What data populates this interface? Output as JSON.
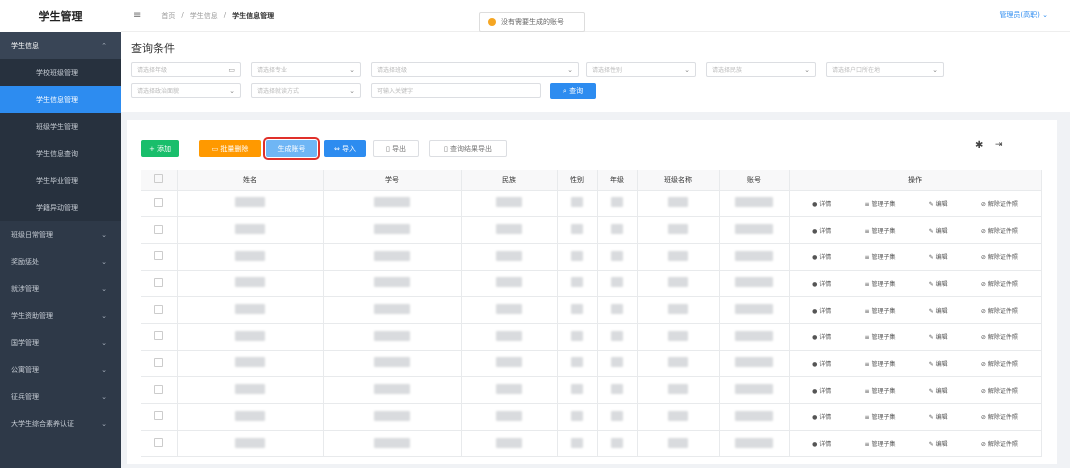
{
  "sidebar": {
    "title": "学生管理",
    "items": [
      {
        "label": "学生信息",
        "type": "parent",
        "chevron": "chevron-up"
      },
      {
        "label": "学校班级管理",
        "type": "sub"
      },
      {
        "label": "学生信息管理",
        "type": "sub-active"
      },
      {
        "label": "班级学生管理",
        "type": "sub"
      },
      {
        "label": "学生信息查询",
        "type": "sub"
      },
      {
        "label": "学生毕业管理",
        "type": "sub"
      },
      {
        "label": "学籍异动管理",
        "type": "sub"
      },
      {
        "label": "班级日常管理",
        "type": "group"
      },
      {
        "label": "奖励惩处",
        "type": "group"
      },
      {
        "label": "就涉管理",
        "type": "group"
      },
      {
        "label": "学生资助管理",
        "type": "group"
      },
      {
        "label": "国学管理",
        "type": "group"
      },
      {
        "label": "公寓管理",
        "type": "group"
      },
      {
        "label": "征兵管理",
        "type": "group"
      },
      {
        "label": "大学生综合素养认证",
        "type": "group"
      }
    ]
  },
  "topbar": {
    "breadcrumb": [
      "首页",
      "学生信息",
      "学生信息管理"
    ],
    "notice": "没有需要生成的账号",
    "user": "管理员(高职)"
  },
  "query": {
    "title": "查询条件",
    "fields": [
      "请选择年级",
      "请选择专业",
      "请选择班级",
      "请选择性别",
      "请选择民族",
      "请选择户口所在地",
      "请选择政治面貌",
      "请选择就读方式",
      "可输入关键字"
    ],
    "search_label": "查询"
  },
  "toolbar": {
    "add": "+ 添加",
    "batch_delete": "批量删除",
    "generate_account": "生成账号",
    "import": "导入",
    "export": "导出",
    "query_export": "查询结果导出"
  },
  "table": {
    "headers": [
      "",
      "姓名",
      "学号",
      "民族",
      "性别",
      "年级",
      "班级名称",
      "账号",
      "操作"
    ],
    "ops": [
      "详情",
      "管理子集",
      "编辑",
      "解除证件照"
    ],
    "row_count": 10
  },
  "colors": {
    "accent": "#2d8cf0",
    "sidebar": "#2e3948",
    "add": "#19be6b",
    "delete": "#ff9900",
    "highlight": "#e0302a"
  }
}
